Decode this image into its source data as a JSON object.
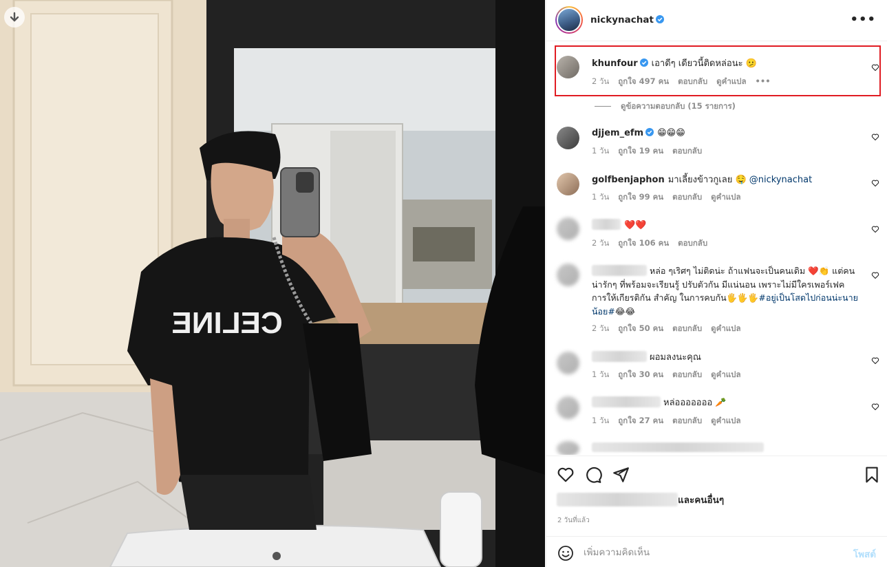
{
  "photo": {
    "shirt_text": "CELINE",
    "download_icon": "arrow-down-icon"
  },
  "header": {
    "username": "nickynachat",
    "verified": true,
    "more_icon": "more-horizontal-icon"
  },
  "comments": [
    {
      "username": "khunfour",
      "verified": true,
      "text": "เอาดีๆ เดียวนี้ติดหล่อนะ 🫤",
      "time": "2 วัน",
      "likes": "ถูกใจ 497 คน",
      "reply": "ตอบกลับ",
      "translate": "ดูคำแปล",
      "more": "•••",
      "highlighted": true,
      "view_replies": "ดูข้อความตอบกลับ (15 รายการ)"
    },
    {
      "username": "djjem_efm",
      "verified": true,
      "text": "😁😁😁",
      "time": "1 วัน",
      "likes": "ถูกใจ 19 คน",
      "reply": "ตอบกลับ"
    },
    {
      "username": "golfbenjaphon",
      "text": "มาเลี้ยงข้าวกูเลย 🤤",
      "mention": "@nickynachat",
      "time": "1 วัน",
      "likes": "ถูกใจ 99 คน",
      "reply": "ตอบกลับ",
      "translate": "ดูคำแปล"
    },
    {
      "username_hidden": true,
      "text": "❤️❤️",
      "time": "2 วัน",
      "likes": "ถูกใจ 106 คน",
      "reply": "ตอบกลับ"
    },
    {
      "username_hidden": true,
      "text": "หล่อ ๆเริศๆ ไม่ติดน่ะ ถ้าแฟนจะเป็นคนเดิม ❤️👏 แต่คนน่ารักๆ ที่พร้อมจะเรียนรู้ ปรับตัวกัน มีแน่นอน เพราะไม่มีใครเพอร์เฟค การให้เกียรติกัน สำคัญ ในการคบกัน🖐🖐🖐",
      "hashtag": "#อยู่เป็นโสดไปก่อนน่ะนายน้อย#",
      "tail_emoji": "😂😂",
      "time": "2 วัน",
      "likes": "ถูกใจ 50 คน",
      "reply": "ตอบกลับ",
      "translate": "ดูคำแปล"
    },
    {
      "username_hidden": true,
      "text": "ผอมลงนะคุณ",
      "time": "1 วัน",
      "likes": "ถูกใจ 30 คน",
      "reply": "ตอบกลับ",
      "translate": "ดูคำแปล"
    },
    {
      "username_hidden": true,
      "text": "หล่อออออออ 🥕",
      "time": "1 วัน",
      "likes": "ถูกใจ 27 คน",
      "reply": "ตอบกลับ",
      "translate": "ดูคำแปล"
    }
  ],
  "actions": {
    "like_icon": "heart-icon",
    "comment_icon": "comment-icon",
    "share_icon": "send-icon",
    "save_icon": "bookmark-icon",
    "likes_suffix": "และคนอื่นๆ",
    "post_time": "2 วันที่แล้ว"
  },
  "composer": {
    "placeholder": "เพิ่มความคิดเห็น",
    "post_label": "โพสต์",
    "emoji_icon": "smiley-icon"
  },
  "colors": {
    "highlight_border": "#e01b22",
    "verified_blue": "#3897f0",
    "link_blue": "#00376b",
    "muted_gray": "#8e8e8e",
    "post_disabled": "#b2dffc"
  }
}
